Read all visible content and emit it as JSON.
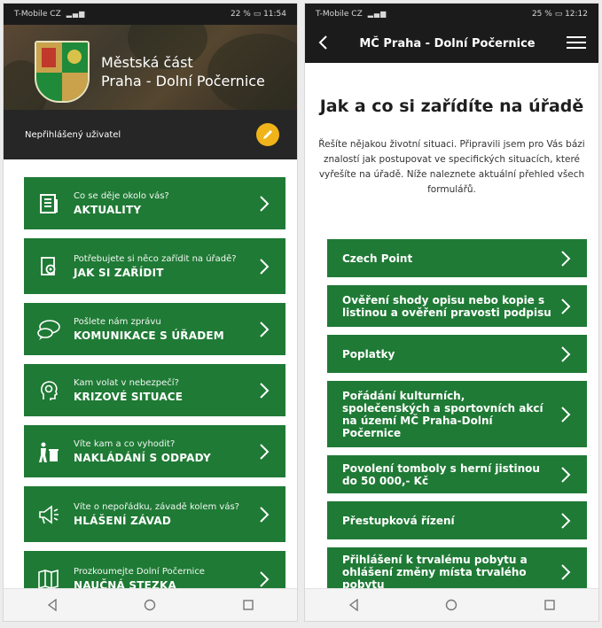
{
  "left": {
    "status": {
      "carrier": "T-Mobile CZ",
      "signal": "▂▄▆",
      "wifi": "WiFi",
      "battery": "22 %",
      "time": "11:54"
    },
    "header": {
      "line1": "Městská část",
      "line2": "Praha - Dolní Počernice"
    },
    "user": {
      "label": "Nepřihlášený uživatel"
    },
    "menu": [
      {
        "sub": "Co se děje okolo vás?",
        "title": "AKTUALITY",
        "icon": "newspaper-icon"
      },
      {
        "sub": "Potřebujete si něco zařídit na úřadě?",
        "title": "JAK SI ZAŘÍDIT",
        "icon": "document-gear-icon"
      },
      {
        "sub": "Pošlete nám zprávu",
        "title": "KOMUNIKACE S ÚŘADEM",
        "icon": "chat-bubbles-icon"
      },
      {
        "sub": "Kam volat v nebezpečí?",
        "title": "KRIZOVÉ SITUACE",
        "icon": "head-gear-icon"
      },
      {
        "sub": "Víte kam a co vyhodit?",
        "title": "NAKLÁDÁNÍ S ODPADY",
        "icon": "recycle-bin-icon"
      },
      {
        "sub": "Víte o nepořádku, závadě kolem vás?",
        "title": "HLÁŠENÍ ZÁVAD",
        "icon": "megaphone-icon"
      },
      {
        "sub": "Prozkoumejte Dolní Počernice",
        "title": "NAUČNÁ STEZKA",
        "icon": "map-icon"
      }
    ]
  },
  "right": {
    "status": {
      "carrier": "T-Mobile CZ",
      "signal": "▂▄▆",
      "wifi": "WiFi",
      "battery": "25 %",
      "time": "12:12"
    },
    "appbar": {
      "title": "MČ Praha - Dolní Počernice"
    },
    "heading": "Jak a co si zařídíte na úřadě",
    "description": "Řešíte nějakou životní situaci. Připravili jsem pro Vás bázi znalostí jak postupovat ve specifických situacích, které vyřešíte na úřadě. Níže naleznete aktuální přehled všech formulářů.",
    "items": [
      "Czech Point",
      "Ověření shody opisu nebo kopie s listinou a ověření pravosti podpisu",
      "Poplatky",
      "Pořádání kulturních, společenských a sportovních akcí na území MČ Praha-Dolní Počernice",
      "Povolení tomboly s herní jistinou do 50 000,- Kč",
      "Přestupková řízení",
      "Přihlášení k trvalému pobytu a ohlášení změny místa trvalého pobytu"
    ]
  },
  "colors": {
    "green": "#1f7a35",
    "dark": "#1b1b1b",
    "accent": "#f0b41a"
  }
}
